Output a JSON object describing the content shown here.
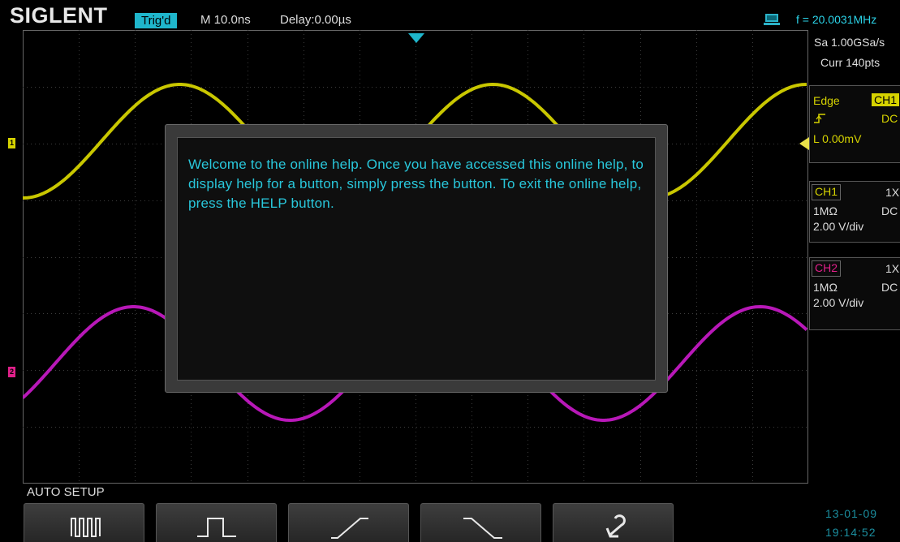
{
  "topbar": {
    "brand": "SIGLENT",
    "trigger_status": "Trig'd",
    "timebase": "M 10.0ns",
    "delay": "Delay:0.00µs",
    "frequency": "f = 20.0031MHz"
  },
  "acquisition": {
    "sample_rate": "Sa 1.00GSa/s",
    "curr_points": "Curr 140pts"
  },
  "trigger": {
    "type": "Edge",
    "source": "CH1",
    "coupling": "DC",
    "level": "L  0.00mV"
  },
  "channels": [
    {
      "name": "CH1",
      "probe": "1X",
      "impedance": "1MΩ",
      "coupling": "DC",
      "scale": "2.00 V/div",
      "color": "#d6d300",
      "marker": "1"
    },
    {
      "name": "CH2",
      "probe": "1X",
      "impedance": "1MΩ",
      "coupling": "DC",
      "scale": "2.00 V/div",
      "color": "#c81ec8",
      "marker": "2"
    }
  ],
  "help": {
    "message": "Welcome to the online help. Once you have accessed this online help, to display help for a button, simply press the button. To exit the online help, press the HELP button."
  },
  "menu": {
    "title": "AUTO SETUP",
    "softkeys": [
      "multi-cycle-icon",
      "single-cycle-icon",
      "rising-edge-icon",
      "falling-edge-icon",
      "undo-icon"
    ]
  },
  "datetime": {
    "date": "13-01-09",
    "time": "19:14:52"
  },
  "colors": {
    "accent": "#1fb6cc",
    "ch1": "#d6d300",
    "ch2": "#c81ec8",
    "help_text": "#29c7db"
  }
}
